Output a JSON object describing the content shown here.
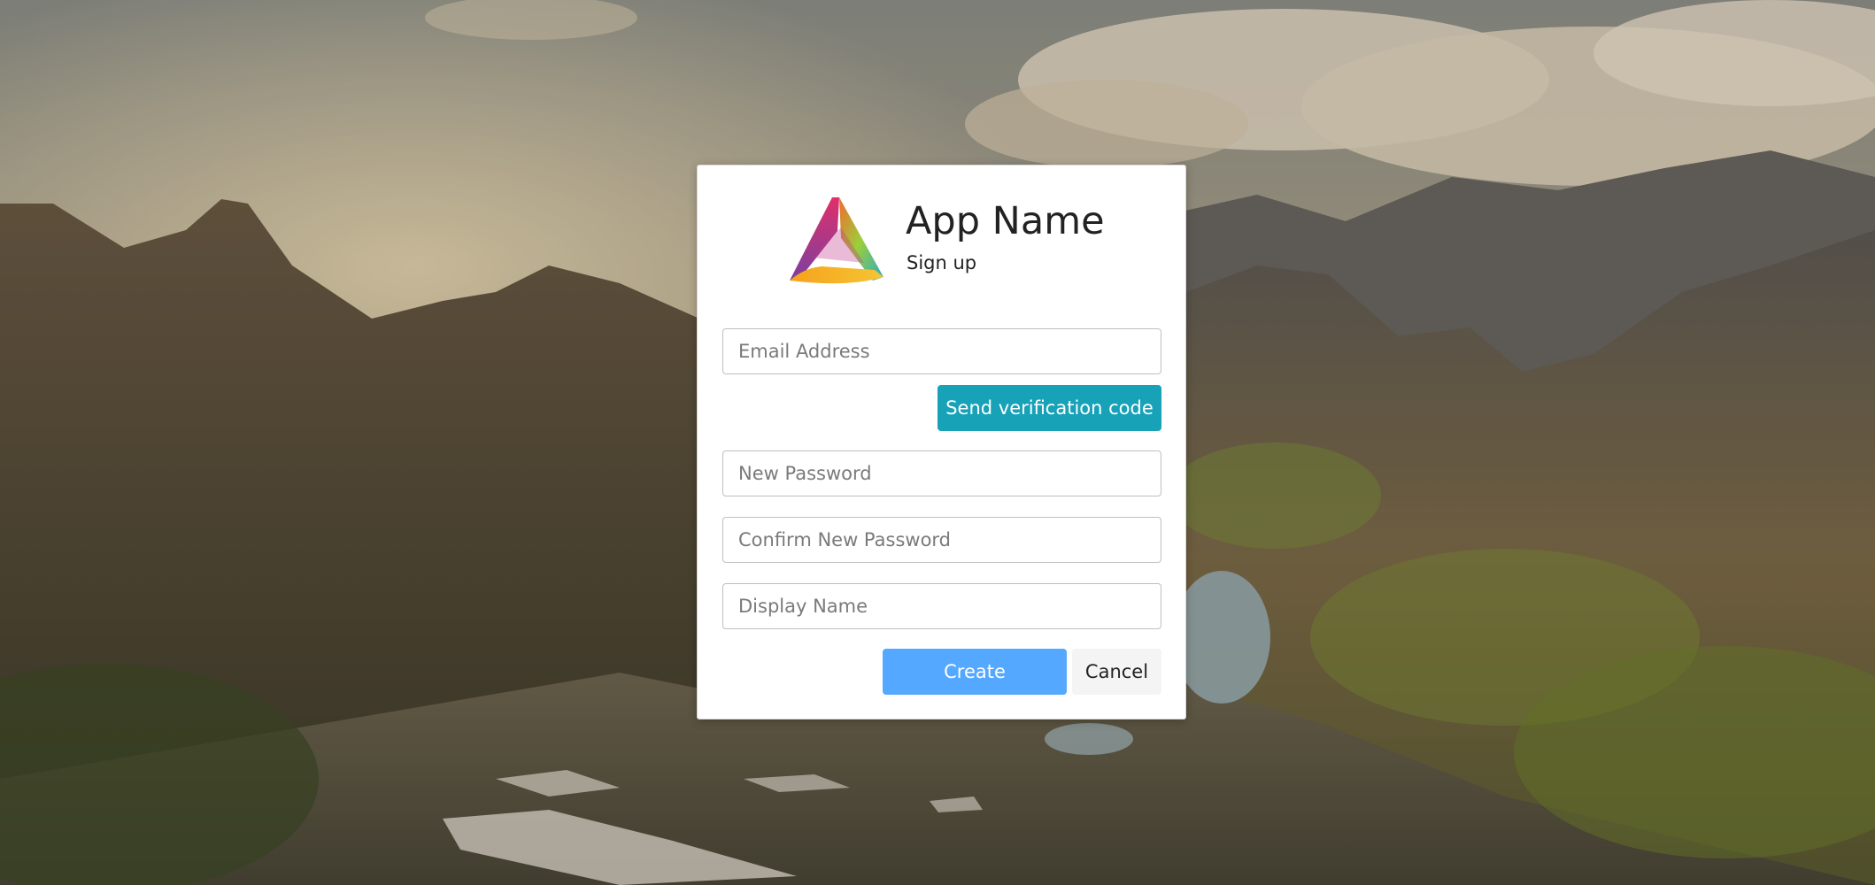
{
  "header": {
    "app_name": "App Name",
    "subtitle": "Sign up",
    "logo_icon": "app-logo-icon"
  },
  "form": {
    "email_placeholder": "Email Address",
    "send_code_label": "Send verification code",
    "new_password_placeholder": "New Password",
    "confirm_password_placeholder": "Confirm New Password",
    "display_name_placeholder": "Display Name",
    "create_label": "Create",
    "cancel_label": "Cancel"
  },
  "colors": {
    "verify_button": "#17a2b8",
    "create_button": "#54a8ff",
    "cancel_button": "#f4f4f4"
  },
  "background": {
    "icon": "mountain-landscape-image"
  }
}
